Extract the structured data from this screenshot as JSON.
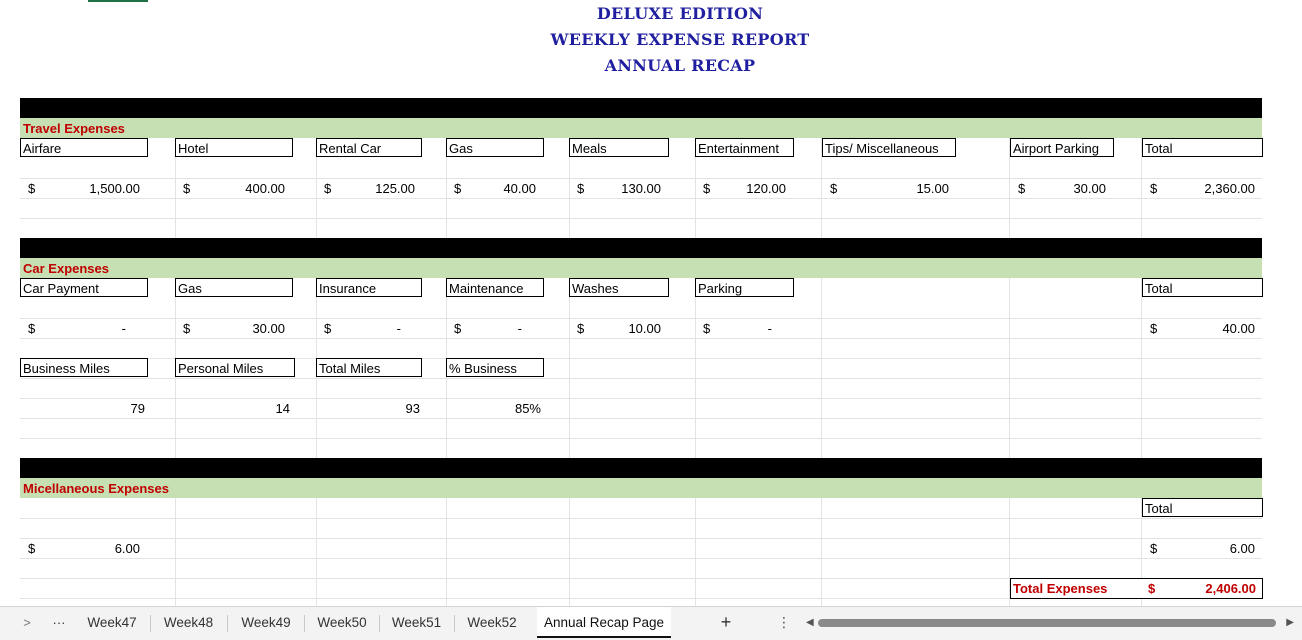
{
  "report": {
    "title_lines": [
      "DELUXE EDITION",
      "WEEKLY EXPENSE REPORT",
      "ANNUAL RECAP"
    ]
  },
  "travel": {
    "label": "Travel Expenses",
    "headers": [
      "Airfare",
      "Hotel",
      "Rental Car",
      "Gas",
      "Meals",
      "Entertainment",
      "Tips/ Miscellaneous",
      "Airport Parking",
      "Total"
    ],
    "currency": "$",
    "values": [
      "1,500.00",
      "400.00",
      "125.00",
      "40.00",
      "130.00",
      "120.00",
      "15.00",
      "30.00",
      "2,360.00"
    ]
  },
  "car": {
    "label": "Car Expenses",
    "headers": [
      "Car Payment",
      "Gas",
      "Insurance",
      "Maintenance",
      "Washes",
      "Parking",
      "Total"
    ],
    "currency": "$",
    "values": [
      "-",
      "30.00",
      "-",
      "-",
      "10.00",
      "-",
      "40.00"
    ],
    "miles_headers": [
      "Business Miles",
      "Personal Miles",
      "Total Miles",
      "% Business"
    ],
    "miles_values": [
      "79",
      "14",
      "93",
      "85%"
    ]
  },
  "misc": {
    "label": "Micellaneous Expenses",
    "total_header": "Total",
    "currency": "$",
    "value": "6.00",
    "total_value": "6.00"
  },
  "grand_total": {
    "label": "Total Expenses",
    "currency": "$",
    "value": "2,406.00"
  },
  "tabs": {
    "nav_prev": ">",
    "ellipsis": "···",
    "items": [
      "Week47",
      "Week48",
      "Week49",
      "Week50",
      "Week51",
      "Week52",
      "Annual Recap Page"
    ],
    "active_index": 6,
    "add": "+",
    "options": "⋮"
  },
  "colors": {
    "title": "#1f1fa0",
    "section_label": "#c00000",
    "section_band": "#c6e0b4",
    "divider_band": "#000000"
  }
}
